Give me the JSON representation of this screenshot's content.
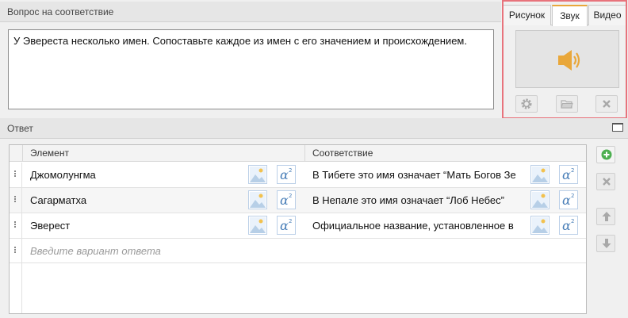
{
  "question": {
    "header": "Вопрос на соответствие",
    "text": "У Эвереста несколько имен. Сопоставьте каждое из имен с его значением и происхождением."
  },
  "media": {
    "tabs": [
      "Рисунок",
      "Звук",
      "Видео"
    ],
    "active_tab": "Звук",
    "accent_color": "#e9a73a",
    "highlight_color": "#e8737c"
  },
  "answer": {
    "header": "Ответ",
    "columns": [
      "Элемент",
      "Соответствие"
    ],
    "rows": [
      {
        "element": "Джомолунгма",
        "match": "В Тибете это имя означает “Мать Богов Зе"
      },
      {
        "element": "Сагарматха",
        "match": "В Непале это имя означает “Лоб Небес”"
      },
      {
        "element": "Эверест",
        "match": "Официальное название, установленное в"
      }
    ],
    "placeholder": "Введите вариант ответа"
  }
}
